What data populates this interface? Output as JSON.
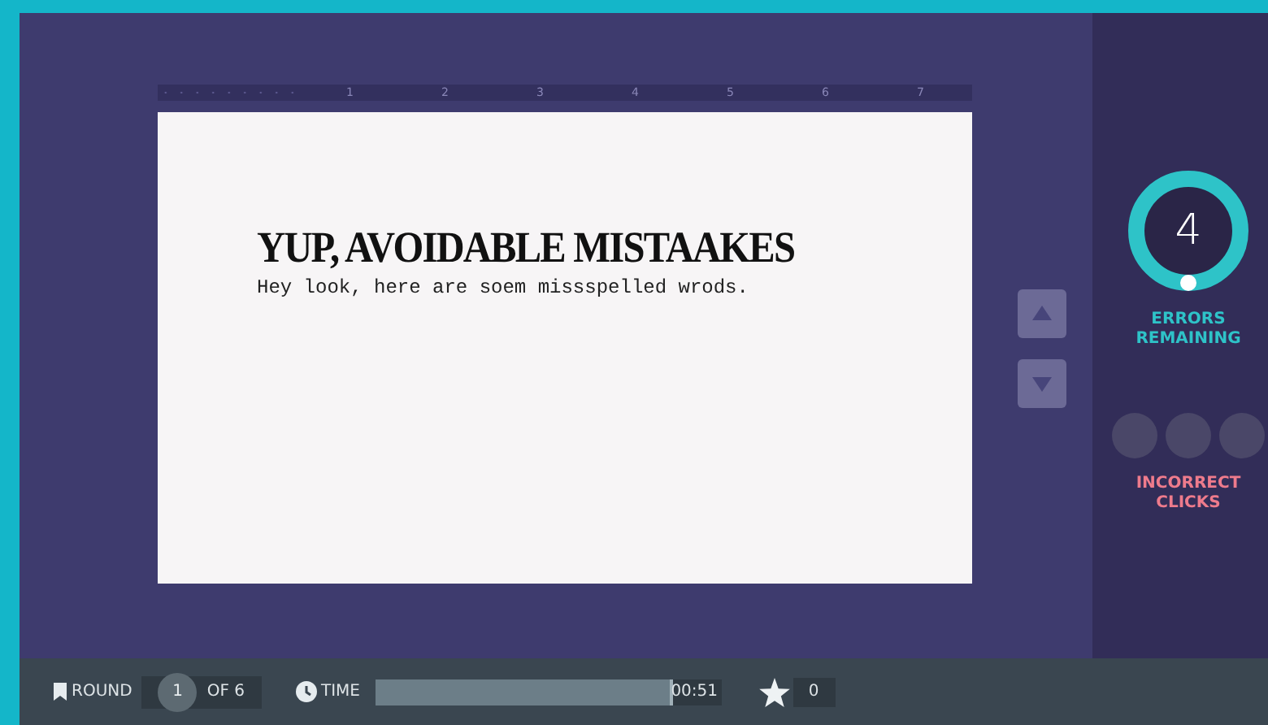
{
  "ruler": {
    "labels": [
      "1",
      "2",
      "3",
      "4",
      "5",
      "6",
      "7"
    ]
  },
  "document": {
    "heading": "YUP, AVOIDABLE MISTAAKES",
    "body": "Hey look, here are soem missspelled wrods."
  },
  "scroll_buttons": [
    {
      "kind": "up"
    },
    {
      "kind": "down"
    }
  ],
  "errors": {
    "count": "4",
    "label": "ERRORS REMAINING"
  },
  "incorrect_clicks": {
    "label": "INCORRECT CLICKS",
    "slots": [
      {
        "filled": false
      },
      {
        "filled": false
      },
      {
        "filled": false
      }
    ]
  },
  "status_bar": {
    "round_label": "ROUND",
    "round": "1",
    "round_total": "OF 6",
    "time": {
      "label": "TIME",
      "value": "00:51",
      "level": 0.86
    },
    "score": "0"
  }
}
